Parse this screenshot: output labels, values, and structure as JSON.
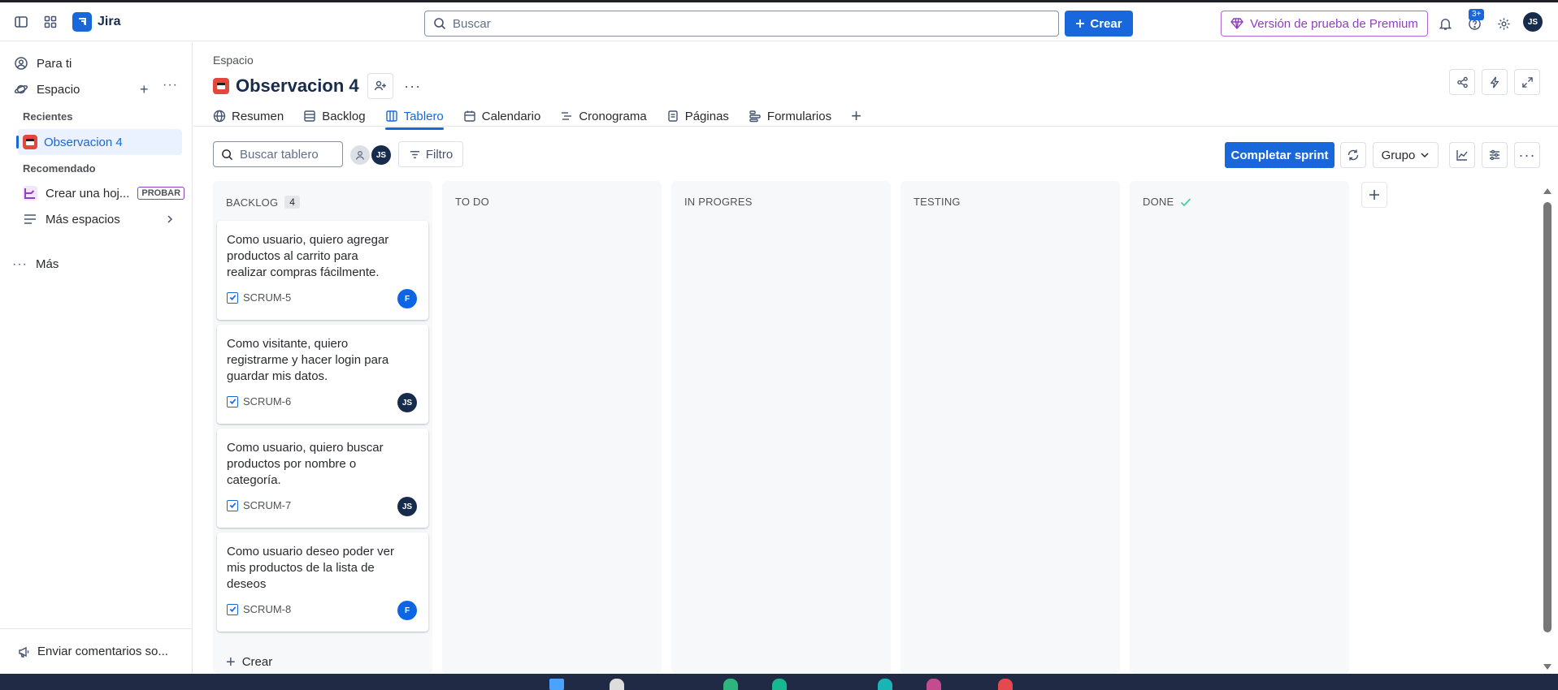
{
  "app": {
    "name": "Jira"
  },
  "topbar": {
    "search_placeholder": "Buscar",
    "create_label": "Crear",
    "premium_label": "Versión de prueba de Premium",
    "help_badge": "3+",
    "user_initials": "JS"
  },
  "sidebar": {
    "for_you": "Para ti",
    "spaces": "Espacio",
    "recent_heading": "Recientes",
    "recent_project": "Observacion 4",
    "recommended_heading": "Recomendado",
    "recommended_item": "Crear una hoj...",
    "recommended_badge": "PROBAR",
    "more_spaces": "Más espacios",
    "more": "Más",
    "feedback": "Enviar comentarios so..."
  },
  "header": {
    "breadcrumb": "Espacio",
    "title": "Observacion 4"
  },
  "tabs": [
    {
      "label": "Resumen",
      "icon": "globe-icon"
    },
    {
      "label": "Backlog",
      "icon": "list-icon"
    },
    {
      "label": "Tablero",
      "icon": "board-icon",
      "active": true
    },
    {
      "label": "Calendario",
      "icon": "calendar-icon"
    },
    {
      "label": "Cronograma",
      "icon": "timeline-icon"
    },
    {
      "label": "Páginas",
      "icon": "pages-icon"
    },
    {
      "label": "Formularios",
      "icon": "forms-icon"
    }
  ],
  "toolbar": {
    "search_placeholder": "Buscar tablero",
    "avatar_initials": "JS",
    "filter_label": "Filtro",
    "complete_sprint_label": "Completar sprint",
    "group_label": "Grupo"
  },
  "columns": [
    {
      "title": "BACKLOG",
      "count": "4"
    },
    {
      "title": "TO DO"
    },
    {
      "title": "IN PROGRES"
    },
    {
      "title": "TESTING"
    },
    {
      "title": "DONE"
    }
  ],
  "cards": [
    {
      "text": "Como usuario, quiero agregar productos al carrito para realizar compras fácilmente.",
      "key": "SCRUM-5",
      "assignee": "F"
    },
    {
      "text": "Como visitante, quiero registrarme y hacer login para guardar mis datos.",
      "key": "SCRUM-6",
      "assignee": "JS"
    },
    {
      "text": "Como usuario, quiero buscar productos por nombre o categoría.",
      "key": "SCRUM-7",
      "assignee": "JS"
    },
    {
      "text": "Como usuario deseo poder ver mis productos de la lista de deseos",
      "key": "SCRUM-8",
      "assignee": "F"
    }
  ],
  "backlog_create_label": "Crear",
  "colors": {
    "accent": "#1868db",
    "premium": "#8f3fbf",
    "project": "#e2483d"
  }
}
